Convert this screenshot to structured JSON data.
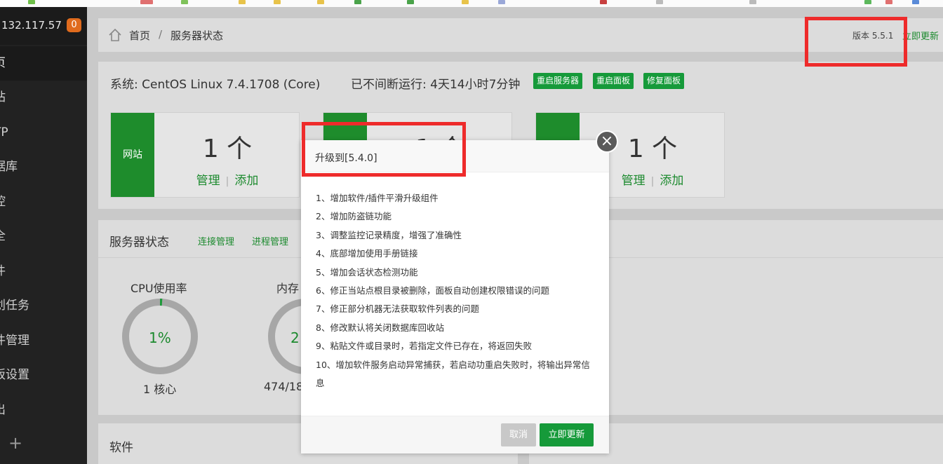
{
  "colors": {
    "accent": "#169a3a",
    "sidebar": "#222222",
    "badge": "#e06b1d",
    "highlight": "#ee2b2b"
  },
  "sidebar": {
    "ip": "132.117.57",
    "badge": "0",
    "items": [
      {
        "label": "页"
      },
      {
        "label": "站"
      },
      {
        "label": "TP"
      },
      {
        "label": "据库"
      },
      {
        "label": "控"
      },
      {
        "label": "全"
      },
      {
        "label": "件"
      },
      {
        "label": "划任务"
      },
      {
        "label": "件管理"
      },
      {
        "label": "板设置"
      },
      {
        "label": "出"
      }
    ],
    "plus": "+"
  },
  "breadcrumb": {
    "home": "首页",
    "sep": "/",
    "current": "服务器状态"
  },
  "version": {
    "label": "版本 5.5.1",
    "update": "立即更新"
  },
  "system": {
    "os": "系统: CentOS Linux 7.4.1708 (Core)",
    "uptime": "已不间断运行: 4天14小时7分钟",
    "buttons": [
      "重启服务器",
      "重启面板",
      "修复面板"
    ]
  },
  "cards": [
    {
      "tag": "网站",
      "count": "1 个",
      "manage": "管理",
      "add": "添加"
    },
    {
      "tag": "",
      "count": "1 个",
      "manage": "",
      "add": ""
    },
    {
      "tag": "",
      "count": "1 个",
      "manage": "管理",
      "add": "添加"
    }
  ],
  "status": {
    "title": "服务器状态",
    "links": [
      "连接管理",
      "进程管理"
    ],
    "cpu": {
      "title": "CPU使用率",
      "value": "1%",
      "sub": "1 核心",
      "percent": 1
    },
    "mem": {
      "title": "内存",
      "value": "2",
      "sub": "474/18"
    }
  },
  "software": {
    "title": "软件"
  },
  "modal": {
    "title": "升级到[5.4.0]",
    "items": [
      "1、增加软件/插件平滑升级组件",
      "2、增加防盗链功能",
      "3、调整监控记录精度，增强了准确性",
      "4、底部增加使用手册链接",
      "5、增加会话状态检测功能",
      "6、修正当站点根目录被删除，面板自动创建权限错误的问题",
      "7、修正部分机器无法获取软件列表的问题",
      "8、修改默认将关闭数据库回收站",
      "9、粘贴文件或目录时，若指定文件已存在，将返回失败",
      "10、增加软件服务启动异常捕获，若启动功重启失败时，将输出异常信息"
    ],
    "cancel": "取消",
    "update": "立即更新",
    "close": "×"
  }
}
